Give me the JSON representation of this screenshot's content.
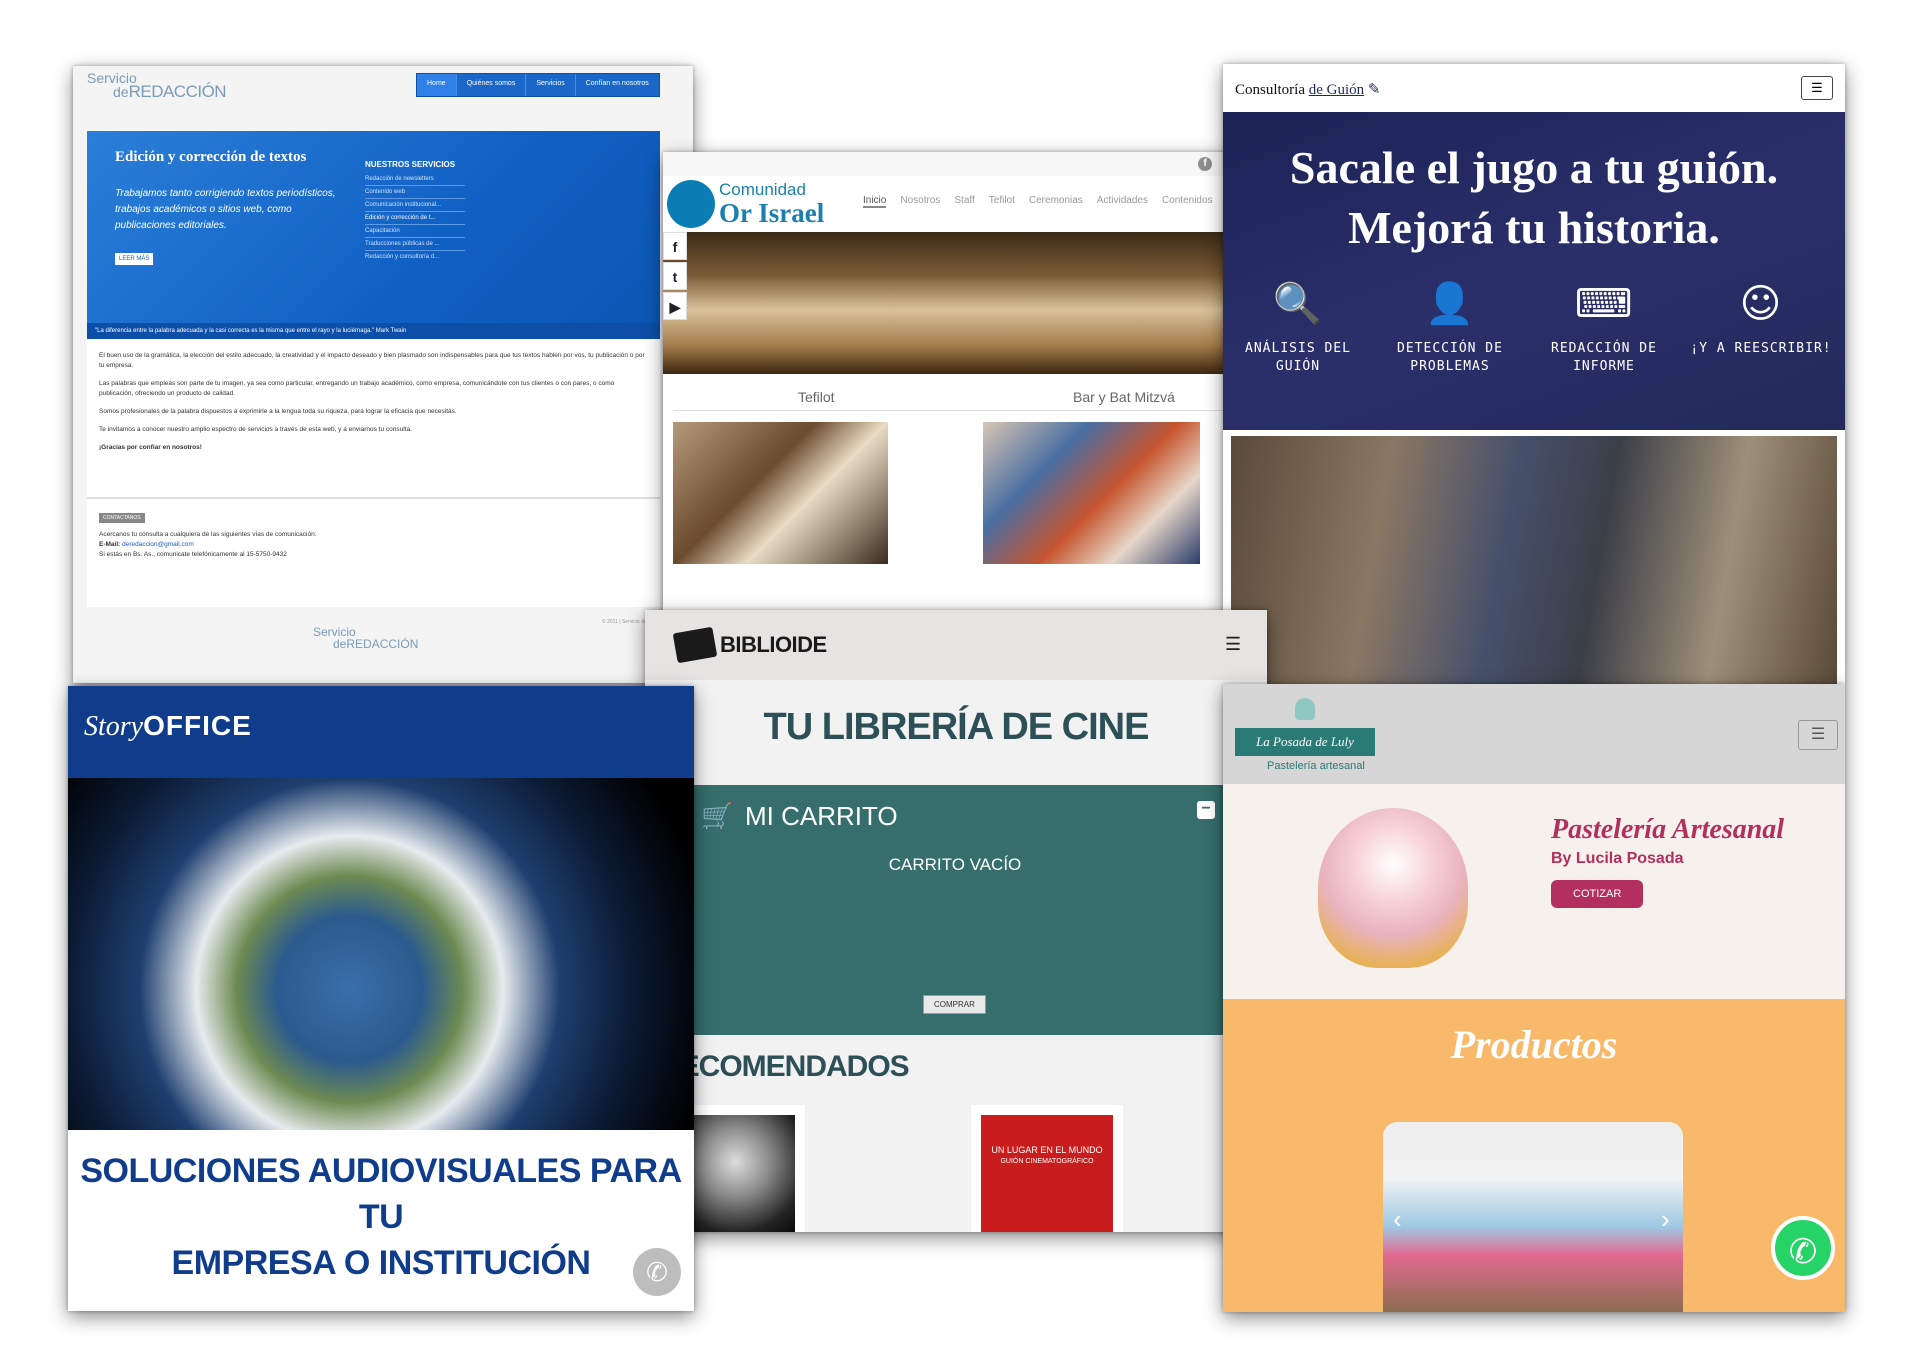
{
  "redaccion": {
    "logo": "Servicio de REDACCIÓN",
    "logo_top": "Servicio",
    "logo_mid": "de",
    "logo_main": "REDACCIÓN",
    "nav": [
      "Home",
      "Quiénes somos",
      "Servicios",
      "Confían en nosotros"
    ],
    "hero_title": "Edición y corrección de textos",
    "hero_text": "Trabajamos tanto corrigiendo textos periodísticos, trabajos académicos o sitios web, como publicaciones editoriales.",
    "hero_button": "LEER MÁS",
    "services_title": "NUESTROS SERVICIOS",
    "services": [
      "Redacción de newsletters",
      "Contenido web",
      "Comunicación institucional...",
      "Edición y corrección de t...",
      "Capacitación",
      "Traducciones públicas de ...",
      "Redacción y consultoría d..."
    ],
    "quote": "\"La diferencia entre la palabra adecuada y la casi correcta es la misma que entre el rayo y la luciérnaga.\" Mark Twain",
    "body": [
      "El buen uso de la gramática, la elección del estilo adecuado, la creatividad y el impacto deseado y bien plasmado son indispensables para que tus textos hablen por vos, tu publicación o por tu empresa.",
      "Las palabras que empleás son parte de tu imagen, ya sea como particular, entregando un trabajo académico, como empresa, comunicándote con tus clientes o con pares, o como publicación, ofreciendo un producto de calidad.",
      "Somos profesionales de la palabra dispuestos a exprimirle a la lengua toda su riqueza, para lograr la eficacia que necesitás.",
      "Te invitamos a conocer nuestro amplio espectro de servicios a través de esta web, y a enviarnos tu consulta.",
      "¡Gracias por confiar en nosotros!"
    ],
    "contact_tag": "CONTACTANOS",
    "contact_intro": "Acercanos tu consulta a cualquiera de las siguientes vías de comunicación:",
    "contact_email_label": "E-Mail:",
    "contact_email": "deredaccion@gmail.com",
    "contact_phone": "Si estás en Bs. As., comunicate telefónicamente al 15-5750-9432",
    "footer": "© 2011 | Servicio de Reda"
  },
  "orisrael": {
    "logo_line1": "Comunidad",
    "logo_line2": "Or Israel",
    "menu": [
      "Inicio",
      "Nosotros",
      "Staff",
      "Tefilot",
      "Ceremonias",
      "Actividades",
      "Contenidos"
    ],
    "social": [
      "f",
      "t",
      "▶"
    ],
    "tab1": "Tefilot",
    "tab2": "Bar y Bat Mitzvá"
  },
  "guion": {
    "brand_prefix": "Consultoría ",
    "brand_link": "de Guión",
    "menu_icon": "☰",
    "headline_line1": "Sacale el jugo a tu guión.",
    "headline_line2": "Mejorá tu historia.",
    "features": [
      {
        "icon": "magnifier-icon",
        "glyph": "🔍",
        "label": "ANÁLISIS DEL GUIÓN"
      },
      {
        "icon": "doctor-icon",
        "glyph": "👤",
        "label": "DETECCIÓN DE PROBLEMAS"
      },
      {
        "icon": "typewriter-icon",
        "glyph": "⌨",
        "label": "REDACCIÓN DE INFORME"
      },
      {
        "icon": "smiley-icon",
        "glyph": "☺",
        "label": "¡Y A REESCRIBIR!"
      }
    ]
  },
  "storyoffice": {
    "logo_story": "Story",
    "logo_office": "OFFICE",
    "title_line1": "SOLUCIONES AUDIOVISUALES PARA TU",
    "title_line2": "EMPRESA O INSTITUCIÓN",
    "whatsapp_glyph": "✆"
  },
  "biblioide": {
    "logo": "BIBLIOIDE",
    "menu_icon": "☰",
    "title": "TU LIBRERÍA DE CINE",
    "cart_title": "MI CARRITO",
    "cart_icon": "🛒",
    "cart_collapse": "−",
    "cart_empty": "CARRITO VACÍO",
    "buy_button": "COMPRAR",
    "recommended": "RECOMENDADOS",
    "book2_title": "UN LUGAR EN EL MUNDO",
    "book2_sub": "GUIÓN CINEMATOGRÁFICO"
  },
  "luly": {
    "brand": "La Posada de Luly",
    "subtitle": "Pastelería artesanal",
    "menu_icon": "☰",
    "hero_title": "Pastelería Artesanal",
    "hero_by": "By Lucila Posada",
    "quote_button": "COTIZAR",
    "products_title": "Productos",
    "prev": "‹",
    "next": "›",
    "whatsapp_glyph": "✆"
  },
  "colors": {
    "redaccion_blue": "#1967c9",
    "guion_navy": "#1c2356",
    "story_blue": "#0f3d8c",
    "biblioide_teal": "#356e6c",
    "luly_pink": "#b22f5e",
    "luly_orange": "#f9b96a"
  }
}
